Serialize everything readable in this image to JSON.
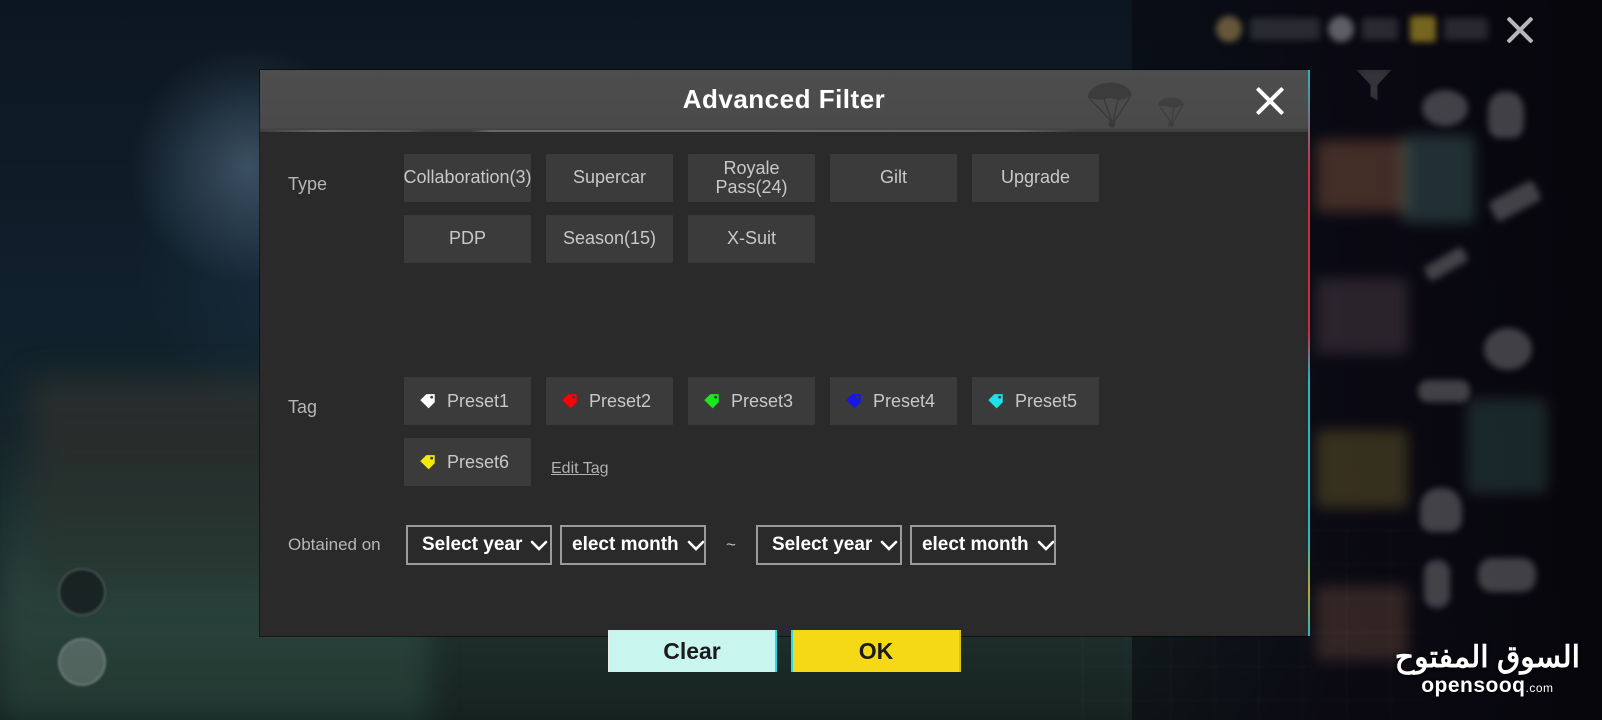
{
  "dialog": {
    "title": "Advanced Filter",
    "close_icon": "close-icon",
    "sections": {
      "type": {
        "label": "Type",
        "options": [
          "Collaboration(3)",
          "Supercar",
          "Royale Pass(24)",
          "Gilt",
          "Upgrade",
          "PDP",
          "Season(15)",
          "X-Suit"
        ]
      },
      "tag": {
        "label": "Tag",
        "edit_label": "Edit Tag",
        "presets": [
          {
            "label": "Preset1",
            "color": "#ffffff"
          },
          {
            "label": "Preset2",
            "color": "#f40606"
          },
          {
            "label": "Preset3",
            "color": "#1ae81a"
          },
          {
            "label": "Preset4",
            "color": "#1616e6"
          },
          {
            "label": "Preset5",
            "color": "#1ce0ee"
          },
          {
            "label": "Preset6",
            "color": "#f2e80a"
          }
        ]
      },
      "obtained_on": {
        "label": "Obtained on",
        "separator": "~",
        "from": {
          "year": {
            "value": "Select year",
            "placeholder": "Select year"
          },
          "month": {
            "value": "elect month",
            "placeholder": "Select month"
          }
        },
        "to": {
          "year": {
            "value": "Select year",
            "placeholder": "Select year"
          },
          "month": {
            "value": "elect month",
            "placeholder": "Select month"
          }
        }
      }
    },
    "footer": {
      "clear_label": "Clear",
      "clear_color": "#c9f5ef",
      "ok_label": "OK",
      "ok_color": "#f5d916"
    }
  },
  "watermark": {
    "arabic": "السوق المفتوح",
    "latin": "opensooq",
    "tld": ".com"
  },
  "theme": {
    "header_bg": "#4a4a4a",
    "body_bg": "#2a2a2a",
    "chip_bg": "#3b3b3b",
    "chip_text": "#c8c8c8",
    "label_text": "#b6b6b6"
  }
}
